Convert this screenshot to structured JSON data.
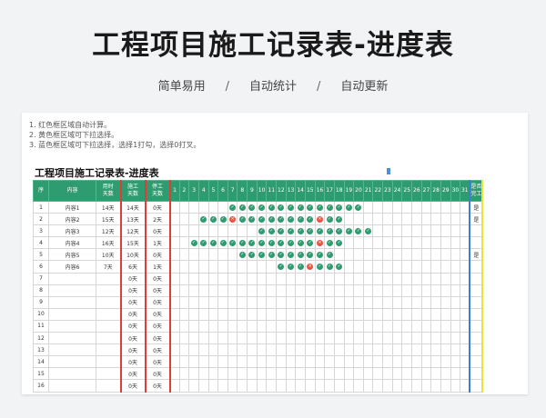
{
  "header": {
    "title": "工程项目施工记录表-进度表",
    "features": [
      "简单易用",
      "自动统计",
      "自动更新"
    ],
    "separator": "/"
  },
  "sheet": {
    "notes": [
      "1. 红色框区域自动计算。",
      "2. 黄色框区域可下拉选择。",
      "3. 蓝色框区域可下拉选择，选择1打勾，选择0打叉。"
    ],
    "title": "工程项目施工记录表-进度表",
    "columns": {
      "seq": "序",
      "content": "内容",
      "planned": [
        "用时",
        "天数"
      ],
      "built": [
        "施工",
        "天数"
      ],
      "stopped": [
        "停工",
        "天数"
      ],
      "days": [
        "1",
        "2",
        "3",
        "4",
        "5",
        "6",
        "7",
        "8",
        "9",
        "10",
        "11",
        "12",
        "13",
        "14",
        "15",
        "16",
        "17",
        "18",
        "19",
        "20",
        "21",
        "22",
        "23",
        "24",
        "25",
        "26",
        "27",
        "28",
        "29",
        "30",
        "31"
      ],
      "done": [
        "是否",
        "完工"
      ]
    },
    "rows": [
      {
        "seq": "1",
        "content": "内容1",
        "planned": "14天",
        "built": "14天",
        "stopped": "0天",
        "marks": {
          "7": 1,
          "8": 1,
          "9": 1,
          "10": 1,
          "11": 1,
          "12": 1,
          "13": 1,
          "14": 1,
          "15": 1,
          "16": 1,
          "17": 1,
          "18": 1,
          "19": 1,
          "20": 1
        },
        "done": "是"
      },
      {
        "seq": "2",
        "content": "内容2",
        "planned": "15天",
        "built": "13天",
        "stopped": "2天",
        "marks": {
          "4": 1,
          "5": 1,
          "6": 1,
          "7": 0,
          "8": 1,
          "9": 1,
          "10": 1,
          "11": 1,
          "12": 1,
          "13": 1,
          "14": 1,
          "15": 1,
          "16": 0,
          "17": 1,
          "18": 1
        },
        "done": "是"
      },
      {
        "seq": "3",
        "content": "内容3",
        "planned": "12天",
        "built": "12天",
        "stopped": "0天",
        "marks": {
          "10": 1,
          "11": 1,
          "12": 1,
          "13": 1,
          "14": 1,
          "15": 1,
          "16": 1,
          "17": 1,
          "18": 1,
          "19": 1,
          "20": 1,
          "21": 1
        },
        "done": ""
      },
      {
        "seq": "4",
        "content": "内容4",
        "planned": "16天",
        "built": "15天",
        "stopped": "1天",
        "marks": {
          "3": 1,
          "4": 1,
          "5": 1,
          "6": 1,
          "7": 1,
          "8": 1,
          "9": 1,
          "10": 1,
          "11": 1,
          "12": 1,
          "13": 1,
          "14": 1,
          "15": 1,
          "16": 0,
          "17": 1,
          "18": 1
        },
        "done": ""
      },
      {
        "seq": "5",
        "content": "内容5",
        "planned": "10天",
        "built": "10天",
        "stopped": "0天",
        "marks": {
          "8": 1,
          "9": 1,
          "10": 1,
          "11": 1,
          "12": 1,
          "13": 1,
          "14": 1,
          "15": 1,
          "16": 1,
          "17": 1
        },
        "done": "是"
      },
      {
        "seq": "6",
        "content": "内容6",
        "planned": "7天",
        "built": "6天",
        "stopped": "1天",
        "marks": {
          "12": 1,
          "13": 1,
          "14": 1,
          "15": 0,
          "16": 1,
          "17": 1,
          "18": 1
        },
        "done": ""
      },
      {
        "seq": "7",
        "content": "",
        "planned": "",
        "built": "0天",
        "stopped": "0天",
        "marks": {},
        "done": ""
      },
      {
        "seq": "8",
        "content": "",
        "planned": "",
        "built": "0天",
        "stopped": "0天",
        "marks": {},
        "done": ""
      },
      {
        "seq": "9",
        "content": "",
        "planned": "",
        "built": "0天",
        "stopped": "0天",
        "marks": {},
        "done": ""
      },
      {
        "seq": "10",
        "content": "",
        "planned": "",
        "built": "0天",
        "stopped": "0天",
        "marks": {},
        "done": ""
      },
      {
        "seq": "11",
        "content": "",
        "planned": "",
        "built": "0天",
        "stopped": "0天",
        "marks": {},
        "done": ""
      },
      {
        "seq": "12",
        "content": "",
        "planned": "",
        "built": "0天",
        "stopped": "0天",
        "marks": {},
        "done": ""
      },
      {
        "seq": "13",
        "content": "",
        "planned": "",
        "built": "0天",
        "stopped": "0天",
        "marks": {},
        "done": ""
      },
      {
        "seq": "14",
        "content": "",
        "planned": "",
        "built": "0天",
        "stopped": "0天",
        "marks": {},
        "done": ""
      },
      {
        "seq": "15",
        "content": "",
        "planned": "",
        "built": "0天",
        "stopped": "0天",
        "marks": {},
        "done": ""
      },
      {
        "seq": "16",
        "content": "",
        "planned": "",
        "built": "0天",
        "stopped": "0天",
        "marks": {},
        "done": ""
      }
    ],
    "icons": {
      "check": "check-icon",
      "cross": "cross-icon"
    },
    "colors": {
      "header_green": "#2e9c6f",
      "auto_calc_red": "#e23b3b",
      "dropdown_yellow": "#f1e234",
      "checkbox_blue": "#3a7ed6",
      "cross_red": "#e8533f"
    }
  }
}
